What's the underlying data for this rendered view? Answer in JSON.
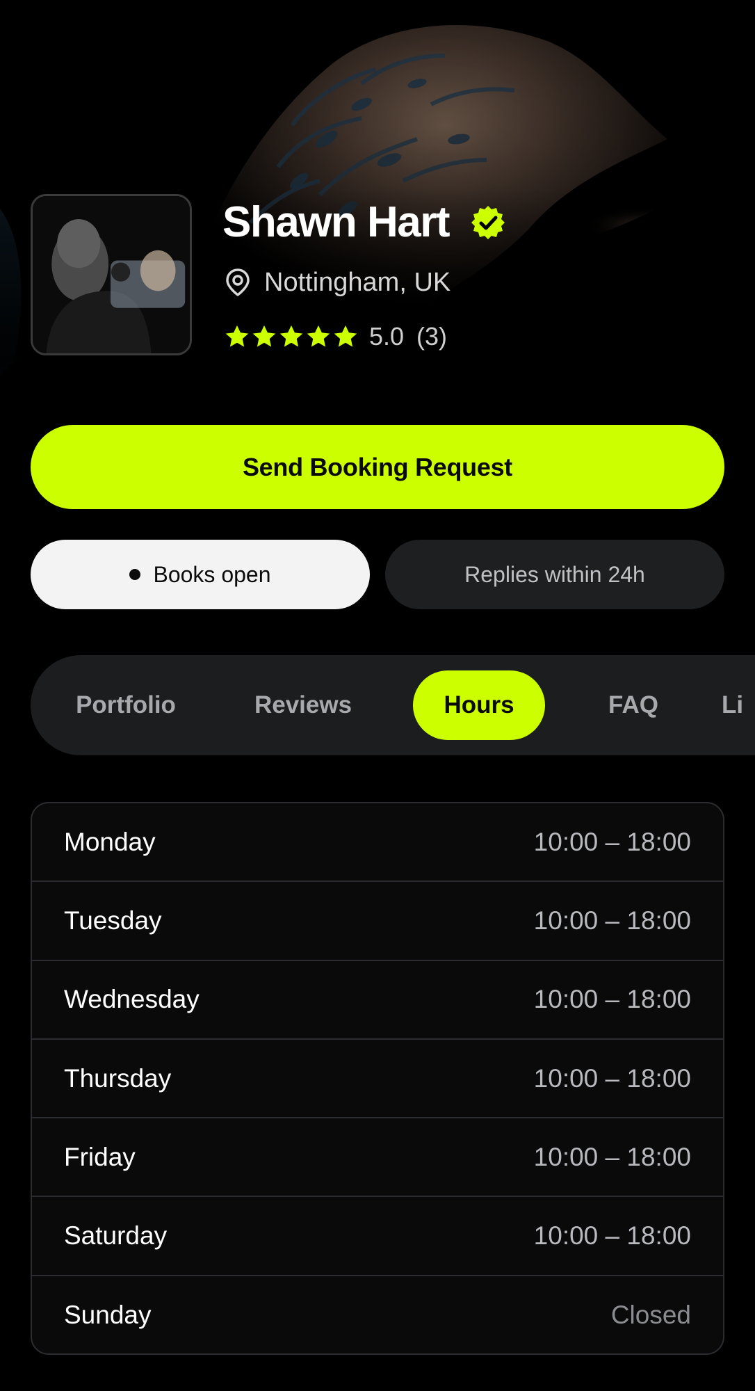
{
  "profile": {
    "name": "Shawn Hart",
    "location": "Nottingham, UK",
    "rating_value": "5.0",
    "rating_count": "(3)",
    "stars_filled": 5,
    "stars_total": 5,
    "verified": true
  },
  "actions": {
    "booking_label": "Send Booking Request",
    "books_status": "Books open",
    "reply_time": "Replies within 24h"
  },
  "tabs": [
    {
      "label": "Portfolio",
      "active": false
    },
    {
      "label": "Reviews",
      "active": false
    },
    {
      "label": "Hours",
      "active": true
    },
    {
      "label": "FAQ",
      "active": false
    },
    {
      "label": "Li",
      "active": false
    }
  ],
  "hours": [
    {
      "day": "Monday",
      "time": "10:00 – 18:00"
    },
    {
      "day": "Tuesday",
      "time": "10:00 – 18:00"
    },
    {
      "day": "Wednesday",
      "time": "10:00 – 18:00"
    },
    {
      "day": "Thursday",
      "time": "10:00 – 18:00"
    },
    {
      "day": "Friday",
      "time": "10:00 – 18:00"
    },
    {
      "day": "Saturday",
      "time": "10:00 – 18:00"
    },
    {
      "day": "Sunday",
      "time": "Closed"
    }
  ],
  "colors": {
    "accent": "#ccff00",
    "background": "#000000",
    "surface": "#1c1d1f",
    "border": "#2c2d30"
  },
  "icons": {
    "verified": "verified-badge-icon",
    "location": "map-pin-icon",
    "star": "star-icon",
    "status_dot": "status-dot-icon"
  }
}
